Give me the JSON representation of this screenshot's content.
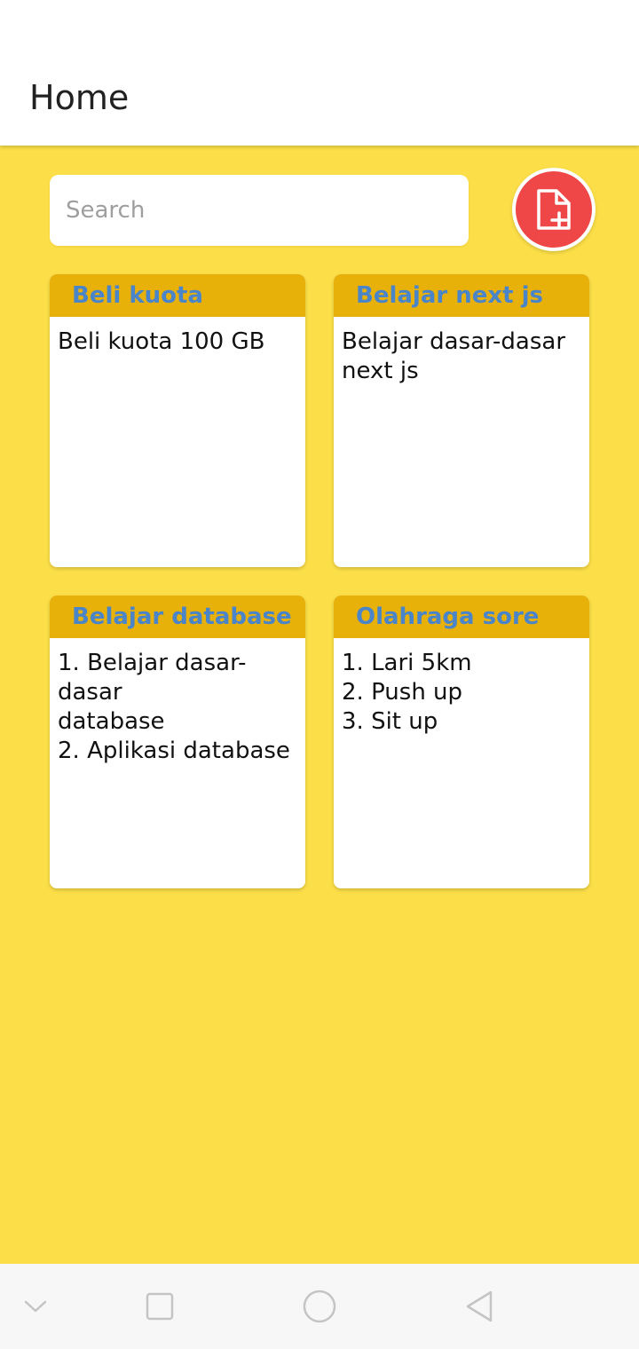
{
  "header": {
    "title": "Home"
  },
  "search": {
    "placeholder": "Search",
    "value": ""
  },
  "add_note": {
    "icon": "file-plus-icon",
    "color": "#EF4747"
  },
  "notes": [
    {
      "title": "Beli kuota",
      "body": "Beli kuota 100 GB"
    },
    {
      "title": "Belajar next js",
      "body": "Belajar dasar-dasar\nnext js"
    },
    {
      "title": "Belajar database",
      "body": "1. Belajar dasar-dasar\ndatabase\n2. Aplikasi database"
    },
    {
      "title": "Olahraga sore",
      "body": "1. Lari 5km\n2. Push up\n3. Sit up"
    }
  ],
  "nav": {
    "items": [
      "chevron-down-icon",
      "square-icon",
      "circle-icon",
      "back-triangle-icon"
    ]
  },
  "colors": {
    "background": "#FCDF48",
    "card_header": "#E8B10A",
    "card_title": "#4A84C9",
    "accent": "#EF4747"
  }
}
